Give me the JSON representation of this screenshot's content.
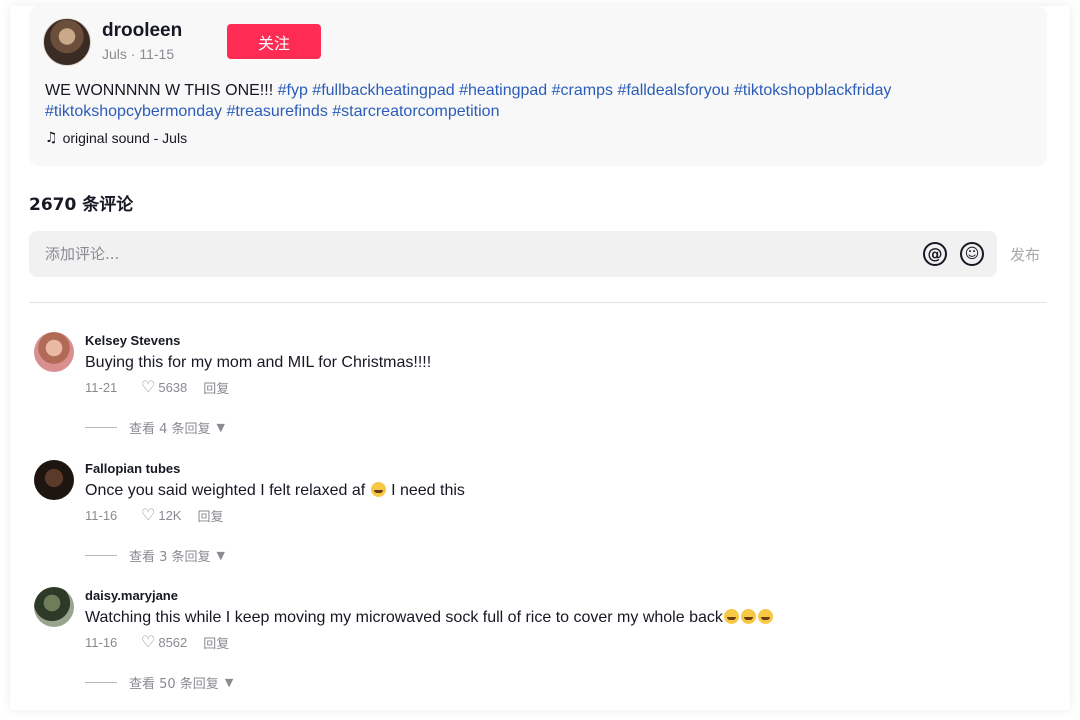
{
  "post": {
    "author_name": "drooleen",
    "author_sub": "Juls · 11-15",
    "follow_label": "关注",
    "caption_text": "WE WONNNNN W THIS ONE!!! ",
    "hashtags": [
      "#fyp",
      "#fullbackheatingpad",
      "#heatingpad",
      "#cramps",
      "#falldealsforyou",
      "#tiktokshopblackfriday",
      "#tiktokshopcybermonday",
      "#treasurefinds",
      "#starcreatorcompetition"
    ],
    "sound": "original sound - Juls"
  },
  "comments_header": {
    "count_label": "2670 条评论",
    "input_placeholder": "添加评论...",
    "post_label": "发布",
    "at_icon": "at-icon",
    "emoji_icon": "emoji-icon"
  },
  "comments": [
    {
      "name": "Kelsey Stevens",
      "text": "Buying this for my mom and MIL for Christmas!!!!",
      "date": "11-21",
      "likes": "5638",
      "reply_label": "回复",
      "view_replies": "查看 4 条回复"
    },
    {
      "name": "Fallopian tubes",
      "text": "Once you said weighted I felt relaxed af",
      "text_after_emoji": " I need this",
      "date": "11-16",
      "likes": "12K",
      "reply_label": "回复",
      "view_replies": "查看 3 条回复"
    },
    {
      "name": "daisy.maryjane",
      "text": "Watching this while I keep moving my microwaved sock full of rice to cover my whole back",
      "date": "11-16",
      "likes": "8562",
      "reply_label": "回复",
      "view_replies": "查看 50 条回复"
    }
  ],
  "colors": {
    "accent": "#fe2c55",
    "hashtag": "#2b5db8",
    "muted": "#8a8b91"
  }
}
